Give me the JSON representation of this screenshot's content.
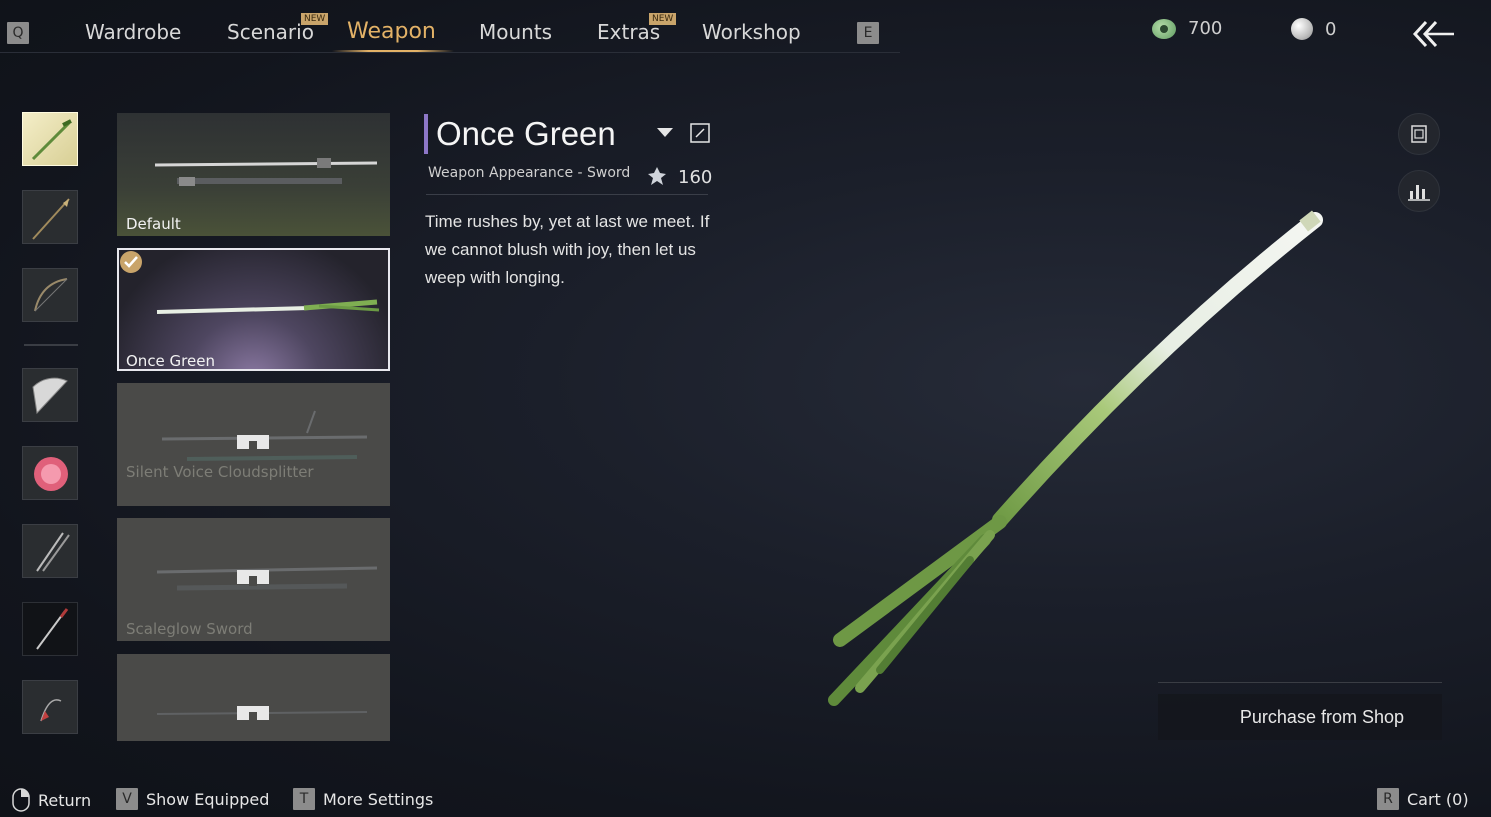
{
  "nav": {
    "left_key": "Q",
    "right_key": "E",
    "tabs": [
      {
        "label": "Wardrobe",
        "new": false
      },
      {
        "label": "Scenario",
        "new": true
      },
      {
        "label": "Weapon",
        "new": false,
        "active": true
      },
      {
        "label": "Mounts",
        "new": false
      },
      {
        "label": "Extras",
        "new": true
      },
      {
        "label": "Workshop",
        "new": false
      }
    ],
    "new_badge": "NEW",
    "active_color": "#e3b267"
  },
  "currency": {
    "jade": {
      "icon": "jade-coin-icon",
      "amount": "700"
    },
    "pearl": {
      "icon": "pearl-icon",
      "amount": "0"
    }
  },
  "categories": [
    {
      "icon": "sword-icon",
      "active": true
    },
    {
      "icon": "spear-icon"
    },
    {
      "icon": "bow-icon"
    },
    {
      "icon": "fan-icon"
    },
    {
      "icon": "umbrella-icon"
    },
    {
      "icon": "dual-blades-icon"
    },
    {
      "icon": "mo-blade-icon"
    },
    {
      "icon": "rope-dart-icon"
    }
  ],
  "items": [
    {
      "name": "Default",
      "state": "owned"
    },
    {
      "name": "Once Green",
      "state": "selected"
    },
    {
      "name": "Silent Voice Cloudsplitter",
      "state": "locked"
    },
    {
      "name": "Scaleglow Sword",
      "state": "locked"
    },
    {
      "name": "",
      "state": "locked"
    }
  ],
  "detail": {
    "title": "Once Green",
    "subtitle": "Weapon Appearance - Sword",
    "rank_value": "160",
    "description": "Time rushes by, yet at last we meet. If we cannot blush with joy, then let us weep with longing.",
    "accent": "#8d77c7"
  },
  "actions": {
    "purchase_label": "Purchase from Shop"
  },
  "footer": {
    "return_label": "Return",
    "show_equipped_key": "V",
    "show_equipped_label": "Show Equipped",
    "more_settings_key": "T",
    "more_settings_label": "More Settings",
    "cart_key": "R",
    "cart_label": "Cart (0)"
  }
}
